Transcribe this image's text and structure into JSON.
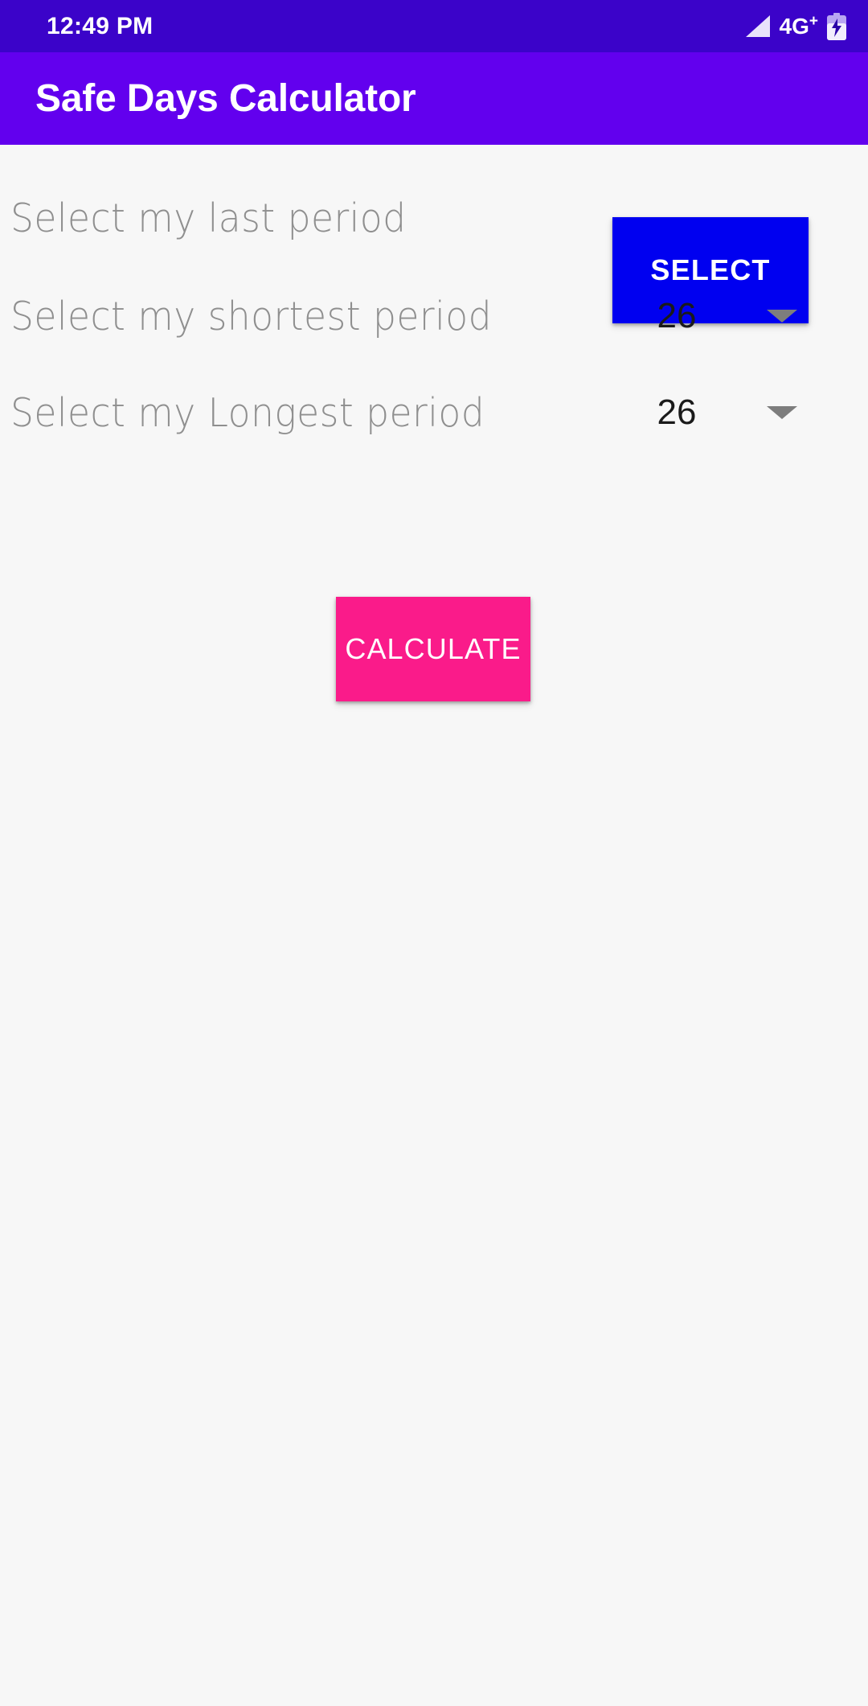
{
  "status_bar": {
    "time": "12:49 PM",
    "network_label": "4G",
    "network_plus": "+",
    "signal_icon": "signal-triangle-icon",
    "battery_icon": "battery-charging-icon",
    "background_color": "#3b03c9"
  },
  "app_bar": {
    "title": "Safe Days Calculator",
    "background_color": "#6200ee",
    "text_color": "#ffffff"
  },
  "form": {
    "rows": [
      {
        "label": "Select my last period",
        "control": "button",
        "value": "SELECT"
      },
      {
        "label": "Select my shortest period",
        "control": "spinner",
        "value": "26"
      },
      {
        "label": "Select my Longest period",
        "control": "spinner",
        "value": "26"
      }
    ],
    "select_button_label": "SELECT",
    "select_button_color": "#0000f0",
    "shortest_value": "26",
    "longest_value": "26",
    "calculate_button_label": "CALCULATE",
    "calculate_button_color": "#fa1b8a",
    "label_color": "#8f8f8f",
    "background_color": "#f7f7f7"
  }
}
